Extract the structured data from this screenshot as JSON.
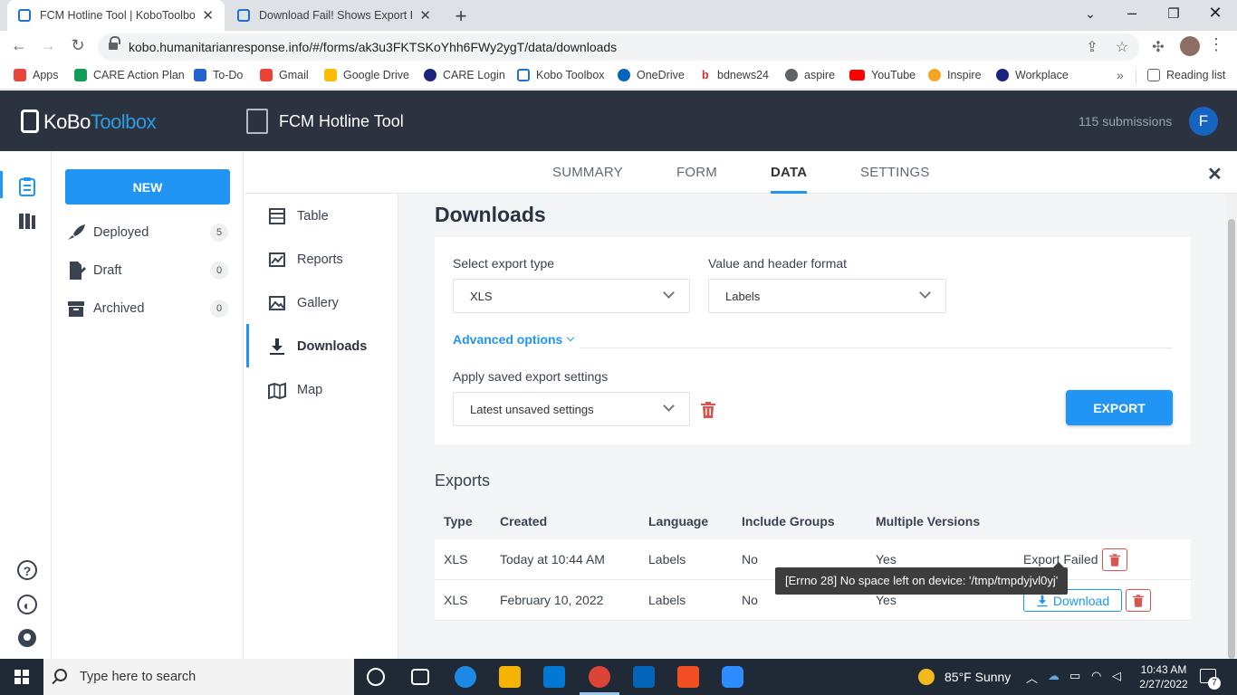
{
  "browser": {
    "tabs": [
      {
        "title": "FCM Hotline Tool | KoboToolbox",
        "active": true
      },
      {
        "title": "Download Fail! Shows Export Fail",
        "active": false
      }
    ],
    "url": "kobo.humanitarianresponse.info/#/forms/ak3u3FKTSKoYhh6FWy2ygT/data/downloads",
    "bookmarks": [
      {
        "label": "Apps",
        "icon": "apps-grid-icon",
        "color": "#e8453c"
      },
      {
        "label": "CARE Action Plan",
        "icon": "sheets-icon",
        "color": "#0f9d58"
      },
      {
        "label": "To-Do",
        "icon": "todo-check-icon",
        "color": "#2564cf"
      },
      {
        "label": "Gmail",
        "icon": "gmail-icon",
        "color": "#ea4335"
      },
      {
        "label": "Google Drive",
        "icon": "google-drive-icon",
        "color": "#fbbc04"
      },
      {
        "label": "CARE Login",
        "icon": "circle-logo-icon",
        "color": "#1a237e"
      },
      {
        "label": "Kobo Toolbox",
        "icon": "kobo-icon",
        "color": "#1e73c8"
      },
      {
        "label": "OneDrive",
        "icon": "onedrive-icon",
        "color": "#0364b8"
      },
      {
        "label": "bdnews24",
        "icon": "bdnews-icon",
        "color": "#d32f2f"
      },
      {
        "label": "aspire",
        "icon": "globe-icon",
        "color": "#5f6368"
      },
      {
        "label": "YouTube",
        "icon": "youtube-icon",
        "color": "#ff0000"
      },
      {
        "label": "Inspire",
        "icon": "inspire-icon",
        "color": "#f5a623"
      },
      {
        "label": "Workplace",
        "icon": "workplace-icon",
        "color": "#1a237e"
      }
    ],
    "more_label": "»",
    "reading_list": "Reading list"
  },
  "app": {
    "logo_kobo": "KoBo",
    "logo_toolbox": "Toolbox",
    "form_title": "FCM Hotline Tool",
    "submissions": "115 submissions",
    "avatar_initial": "F"
  },
  "sidebar": {
    "new_label": "NEW",
    "items": [
      {
        "label": "Deployed",
        "count": "5"
      },
      {
        "label": "Draft",
        "count": "0"
      },
      {
        "label": "Archived",
        "count": "0"
      }
    ]
  },
  "main_tabs": [
    {
      "label": "SUMMARY"
    },
    {
      "label": "FORM"
    },
    {
      "label": "DATA"
    },
    {
      "label": "SETTINGS"
    }
  ],
  "data_nav": [
    {
      "label": "Table"
    },
    {
      "label": "Reports"
    },
    {
      "label": "Gallery"
    },
    {
      "label": "Downloads"
    },
    {
      "label": "Map"
    }
  ],
  "downloads": {
    "title": "Downloads",
    "export_type_label": "Select export type",
    "export_type_value": "XLS",
    "format_label": "Value and header format",
    "format_value": "Labels",
    "advanced_label": "Advanced options",
    "saved_settings_label": "Apply saved export settings",
    "saved_settings_value": "Latest unsaved settings",
    "export_button": "EXPORT"
  },
  "exports": {
    "title": "Exports",
    "columns": [
      "Type",
      "Created",
      "Language",
      "Include Groups",
      "Multiple Versions"
    ],
    "rows": [
      {
        "type": "XLS",
        "created": "Today at 10:44 AM",
        "language": "Labels",
        "groups": "No",
        "versions": "Yes",
        "status": "Export Failed"
      },
      {
        "type": "XLS",
        "created": "February 10, 2022",
        "language": "Labels",
        "groups": "No",
        "versions": "Yes",
        "status": "Download"
      }
    ],
    "tooltip": "[Errno 28] No space left on device: '/tmp/tmpdyjvl0yj'"
  },
  "taskbar": {
    "search_placeholder": "Type here to search",
    "weather": "85°F  Sunny",
    "time": "10:43 AM",
    "date": "2/27/2022",
    "notifications": "7"
  },
  "colors": {
    "accent": "#2095f3",
    "header_bg": "#2b3341",
    "danger": "#d9534f"
  }
}
